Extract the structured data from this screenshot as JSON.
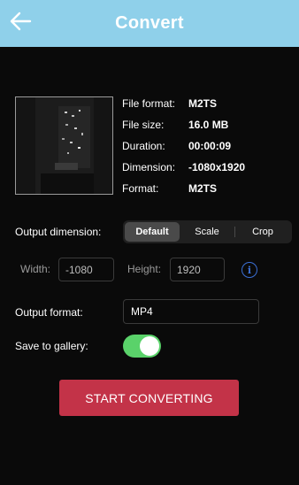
{
  "header": {
    "title": "Convert",
    "back_icon": "arrow-left-icon",
    "bg_color": "#8fd0ea"
  },
  "file_info": {
    "file_format_label": "File format:",
    "file_format_value": "M2TS",
    "file_size_label": "File size:",
    "file_size_value": "16.0 MB",
    "duration_label": "Duration:",
    "duration_value": "00:00:09",
    "dimension_label": "Dimension:",
    "dimension_value": "-1080x1920",
    "format_label": "Format:",
    "format_value": "M2TS"
  },
  "output_dimension": {
    "label": "Output dimension:",
    "options": [
      "Default",
      "Scale",
      "Crop"
    ],
    "selected": "Default"
  },
  "dimensions": {
    "width_label": "Width:",
    "width_value": "-1080",
    "height_label": "Height:",
    "height_value": "1920",
    "info_icon": "info-icon",
    "info_glyph": "i"
  },
  "output_format": {
    "label": "Output format:",
    "value": "MP4"
  },
  "save_to_gallery": {
    "label": "Save to gallery:",
    "enabled": true,
    "on_color": "#5ad26a"
  },
  "start_button": {
    "label": "START CONVERTING",
    "color": "#c33348"
  }
}
